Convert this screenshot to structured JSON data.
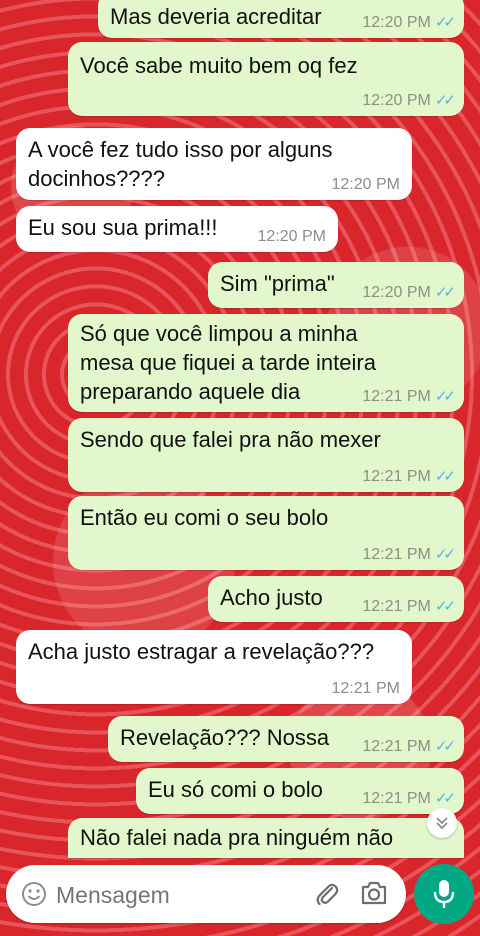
{
  "messages": [
    {
      "dir": "out",
      "text": "Mas deveria acreditar",
      "time": "12:20 PM",
      "ticks": "✓✓"
    },
    {
      "dir": "out",
      "text": "Você sabe muito bem oq fez",
      "time": "12:20 PM",
      "ticks": "✓✓"
    },
    {
      "dir": "in",
      "lines": [
        "A você fez tudo isso por alguns",
        "docinhos????"
      ],
      "time": "12:20 PM"
    },
    {
      "dir": "in",
      "text": "Eu sou sua prima!!!",
      "time": "12:20 PM"
    },
    {
      "dir": "out",
      "text": "Sim \"prima\"",
      "time": "12:20 PM",
      "ticks": "✓✓"
    },
    {
      "dir": "out",
      "lines": [
        "Só que você limpou a minha",
        "mesa que fiquei a tarde inteira",
        "preparando aquele dia"
      ],
      "time": "12:21 PM",
      "ticks": "✓✓"
    },
    {
      "dir": "out",
      "text": "Sendo que falei pra não mexer",
      "time": "12:21 PM",
      "ticks": "✓✓"
    },
    {
      "dir": "out",
      "text": "Então eu comi o seu bolo",
      "time": "12:21 PM",
      "ticks": "✓✓"
    },
    {
      "dir": "out",
      "text": "Acho justo",
      "time": "12:21 PM",
      "ticks": "✓✓"
    },
    {
      "dir": "in",
      "text": "Acha justo estragar a revelação???",
      "time": "12:21 PM"
    },
    {
      "dir": "out",
      "text": "Revelação??? Nossa",
      "time": "12:21 PM",
      "ticks": "✓✓"
    },
    {
      "dir": "out",
      "text": "Eu só comi o bolo",
      "time": "12:21 PM",
      "ticks": "✓✓"
    },
    {
      "dir": "out",
      "text": "Não falei nada pra ninguém não",
      "time": "",
      "ticks": ""
    }
  ],
  "input": {
    "placeholder": "Mensagem"
  },
  "icons": {
    "emoji": "emoji-icon",
    "attach": "paperclip-icon",
    "camera": "camera-icon",
    "mic": "mic-icon",
    "scroll": "double-chevron-down-icon"
  },
  "colors": {
    "outgoing": "#e2f7cb",
    "incoming": "#ffffff",
    "ticks": "#4fb6ec",
    "mic": "#00a884"
  }
}
